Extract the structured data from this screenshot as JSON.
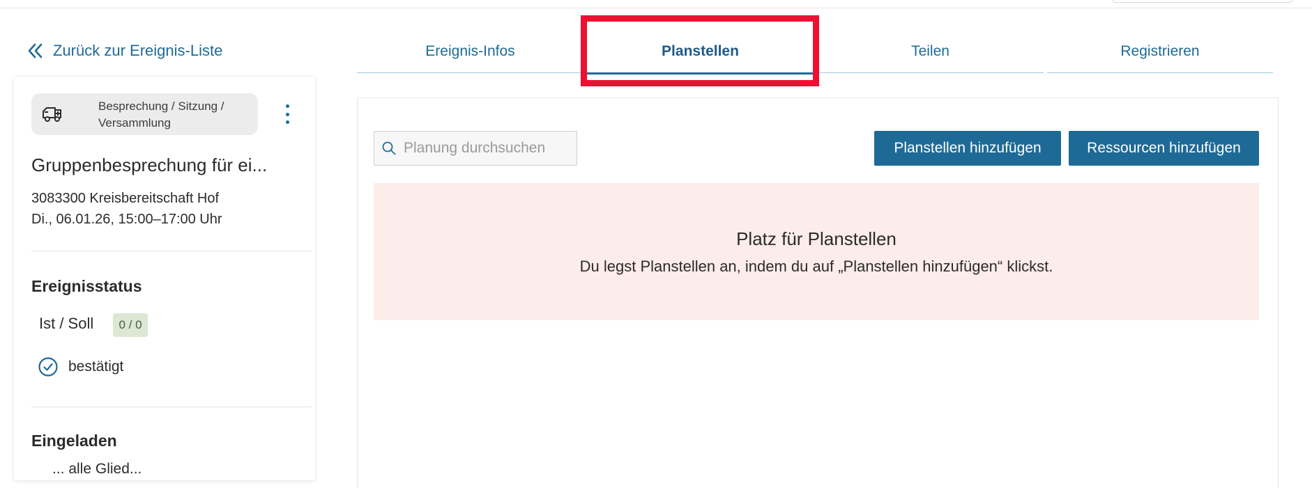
{
  "nav": {
    "back_label": "Zurück zur Ereignis-Liste"
  },
  "event": {
    "type_label": "Besprechung / Sitzung / Versammlung",
    "title": "Gruppenbesprechung für ei...",
    "org": "3083300 Kreisbereitschaft Hof",
    "datetime": "Di., 06.01.26, 15:00–17:00 Uhr",
    "status_heading": "Ereignisstatus",
    "ist_soll_label": "Ist / Soll",
    "ist_soll_value": "0 / 0",
    "status_value": "bestätigt",
    "invited_heading": "Eingeladen",
    "invited_partial": "... alle Glied..."
  },
  "tabs": [
    {
      "label": "Ereignis-Infos",
      "active": false
    },
    {
      "label": "Planstellen",
      "active": true
    },
    {
      "label": "Teilen",
      "active": false
    },
    {
      "label": "Registrieren",
      "active": false
    }
  ],
  "toolbar": {
    "search_placeholder": "Planung durchsuchen",
    "add_planstellen_label": "Planstellen hinzufügen",
    "add_ressourcen_label": "Ressourcen hinzufügen"
  },
  "empty_state": {
    "heading": "Platz für Planstellen",
    "text": "Du legst Planstellen an, indem du auf „Planstellen hinzufügen“ klickst."
  },
  "colors": {
    "accent": "#1e6a96",
    "highlight": "#ee1032",
    "empty_bg": "#fcecea",
    "badge_bg": "#dce8d4"
  },
  "icons": [
    "double-chevron-left-icon",
    "ambulance-icon",
    "kebab-menu-icon",
    "check-circle-icon",
    "search-icon"
  ]
}
